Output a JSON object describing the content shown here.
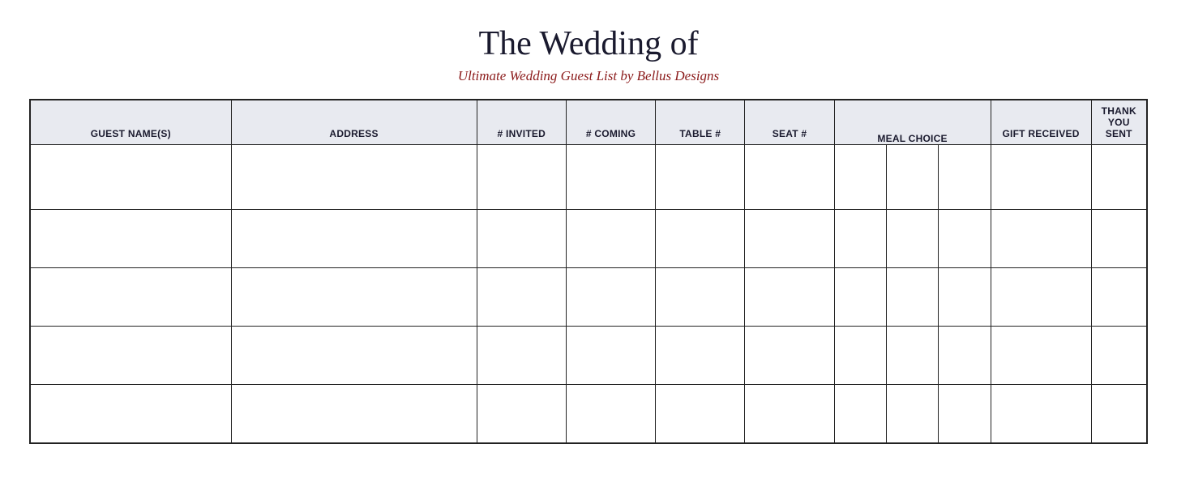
{
  "header": {
    "title": "The Wedding of",
    "subtitle": "Ultimate Wedding Guest List by Bellus Designs"
  },
  "table": {
    "columns": [
      {
        "id": "guest-name",
        "label": "GUEST NAME(S)",
        "class": "col-name"
      },
      {
        "id": "address",
        "label": "ADDRESS",
        "class": "col-address"
      },
      {
        "id": "invited",
        "label": "# INVITED",
        "class": "col-invited"
      },
      {
        "id": "coming",
        "label": "# COMING",
        "class": "col-coming"
      },
      {
        "id": "table",
        "label": "TABLE #",
        "class": "col-table"
      },
      {
        "id": "seat",
        "label": "SEAT #",
        "class": "col-seat"
      },
      {
        "id": "meal",
        "label": "MEAL CHOICE",
        "class": "col-meal-inner"
      },
      {
        "id": "gift",
        "label": "GIFT RECEIVED",
        "class": "col-gift"
      },
      {
        "id": "thank",
        "label": "THANK YOU SENT",
        "class": "col-thank"
      }
    ],
    "rows": [
      [
        "",
        "",
        "",
        "",
        "",
        "",
        "",
        "",
        ""
      ],
      [
        "",
        "",
        "",
        "",
        "",
        "",
        "",
        "",
        ""
      ],
      [
        "",
        "",
        "",
        "",
        "",
        "",
        "",
        "",
        ""
      ],
      [
        "",
        "",
        "",
        "",
        "",
        "",
        "",
        "",
        ""
      ],
      [
        "",
        "",
        "",
        "",
        "",
        "",
        "",
        "",
        ""
      ]
    ]
  }
}
